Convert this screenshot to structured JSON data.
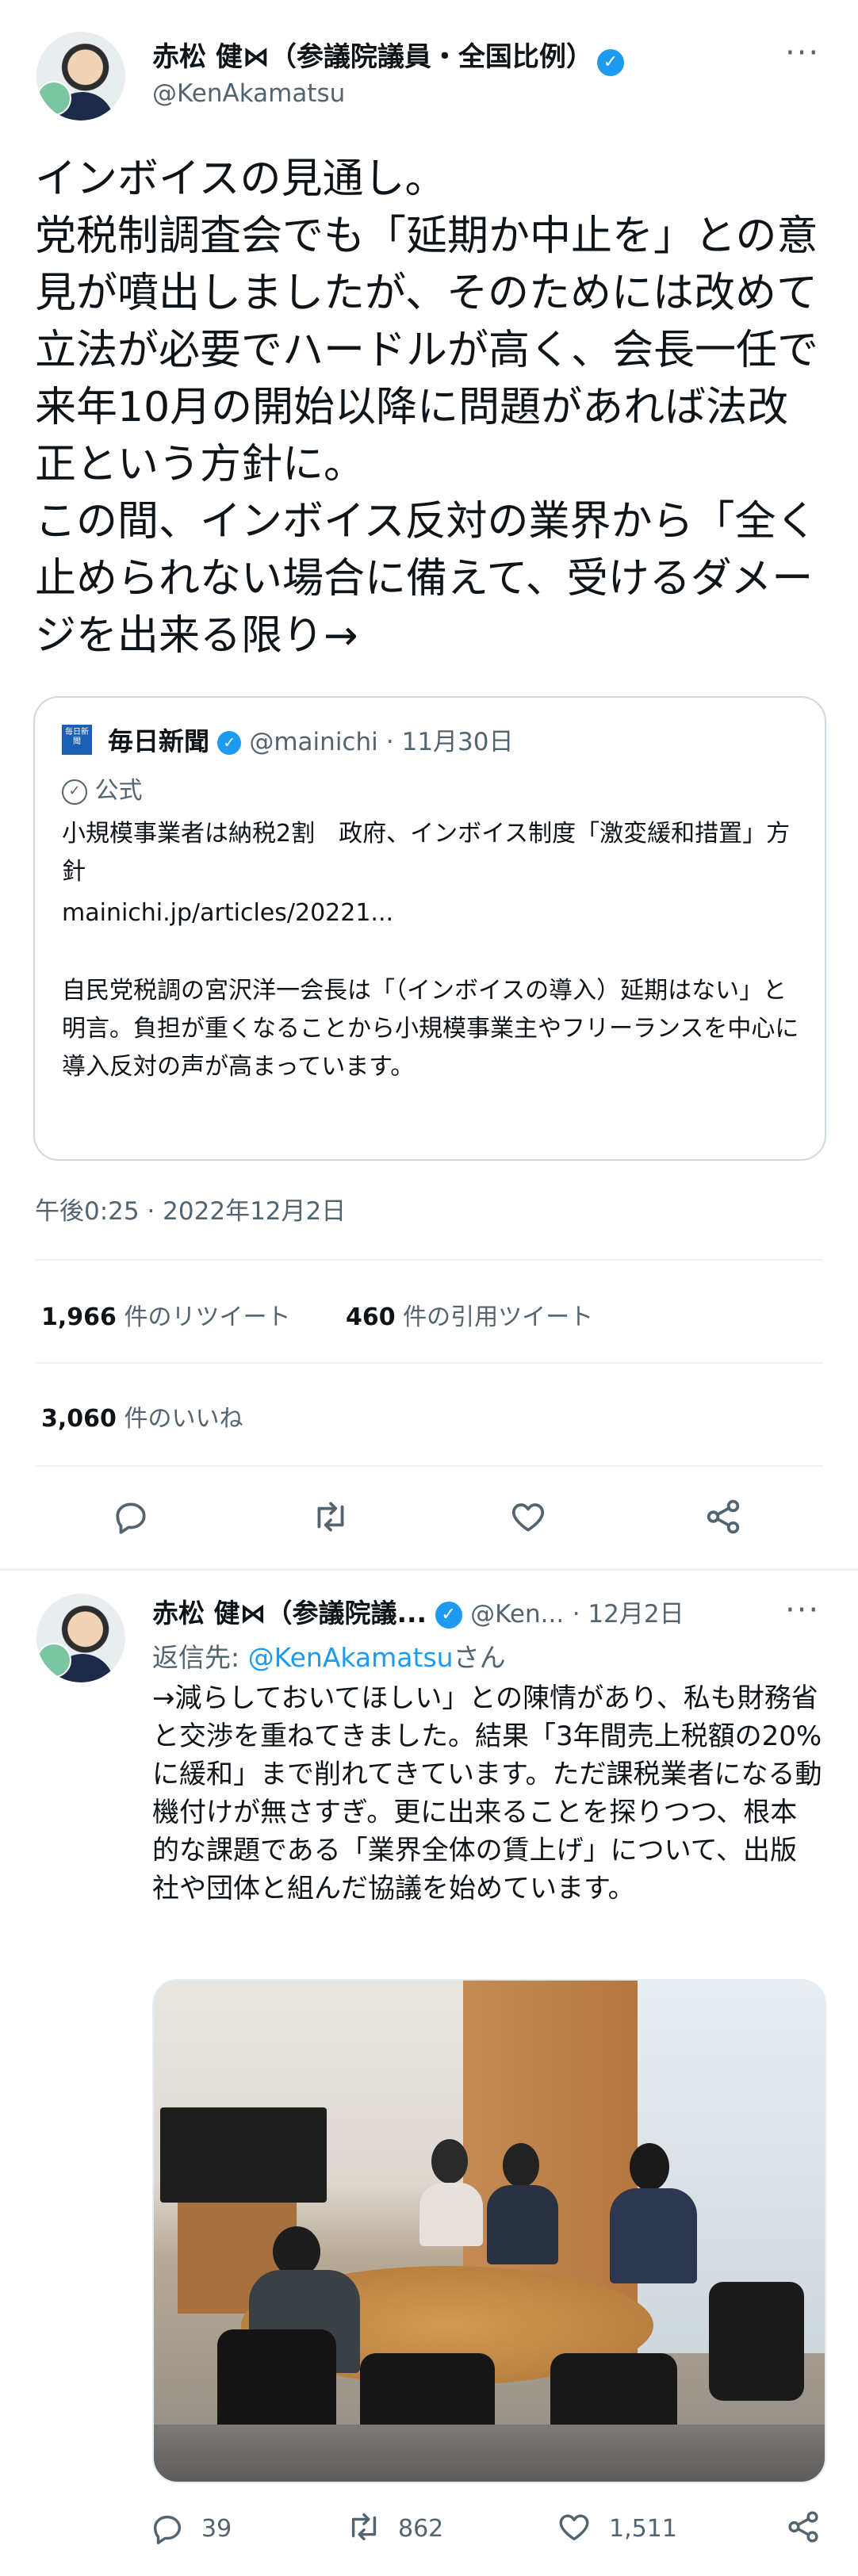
{
  "tweet": {
    "author_name": "赤松 健⋈（参議院議員・全国比例）",
    "author_handle": "@KenAkamatsu",
    "more_glyph": "···",
    "text": "インボイスの見通し。\n党税制調査会でも「延期か中止を」との意見が噴出しましたが、そのためには改めて立法が必要でハードルが高く、会長一任で来年10月の開始以降に問題があれば法改正という方針に。\nこの間、インボイス反対の業界から「全く止められない場合に備えて、受けるダメージを出来る限り→",
    "timestamp": "午後0:25 · 2022年12月2日",
    "stats": {
      "retweets_count": "1,966",
      "retweets_label": "件のリツイート",
      "quotes_count": "460",
      "quotes_label": "件の引用ツイート",
      "likes_count": "3,060",
      "likes_label": "件のいいね"
    }
  },
  "quote": {
    "source_name": "毎日新聞",
    "source_handle": "@mainichi",
    "source_date": "· 11月30日",
    "official_label": "公式",
    "headline": "小規模事業者は納税2割　政府、インボイス制度「激変緩和措置」方針",
    "url": "mainichi.jp/articles/20221...",
    "body": "自民党税調の宮沢洋一会長は「（インボイスの導入）延期はない」と明言。負担が重くなることから小規模事業主やフリーランスを中心に導入反対の声が高まっています。",
    "logo_text": "毎日新聞"
  },
  "reply": {
    "author_name": "赤松 健⋈（参議院議...",
    "author_handle": "@Ken...",
    "date": "· 12月2日",
    "reply_to_prefix": "返信先: ",
    "reply_to_handle": "@KenAkamatsu",
    "reply_to_suffix": "さん",
    "text": "→減らしておいてほしい」との陳情があり、私も財務省と交渉を重ねてきました。結果「3年間売上税額の20%に緩和」まで削れてきています。ただ課税業者になる動機付けが無さすぎ。更に出来ることを探りつつ、根本的な課題である「業界全体の賃上げ」について、出版社や団体と組んだ協議を始めています。",
    "replies": "39",
    "retweets": "862",
    "likes": "1,511"
  },
  "icons": {
    "reply": "reply-icon",
    "retweet": "retweet-icon",
    "like": "heart-icon",
    "share": "share-icon",
    "verified": "verified-badge-icon",
    "official": "official-badge-icon"
  },
  "colors": {
    "accent": "#1d9bf0",
    "muted": "#536471",
    "border": "#cfd9de"
  }
}
